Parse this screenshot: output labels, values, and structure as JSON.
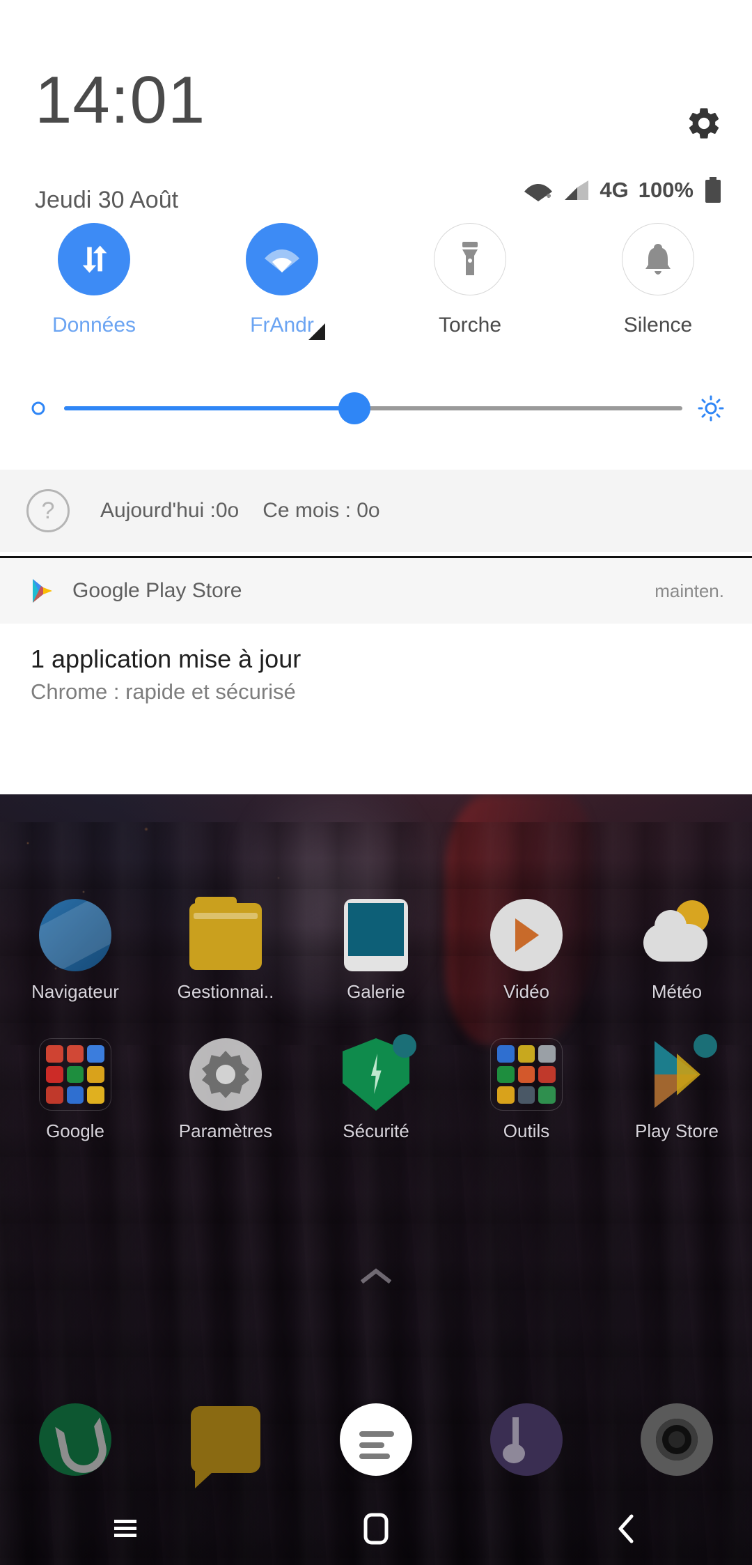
{
  "status_bar": {
    "clock": "14:01",
    "date": "Jeudi 30 Août",
    "network_type": "4G",
    "battery_percent": "100%",
    "icons": [
      "wifi-icon",
      "cellular-signal-icon",
      "battery-icon"
    ],
    "settings_icon": "gear-icon"
  },
  "quick_settings": {
    "tiles": [
      {
        "label": "Données",
        "icon": "data-sync-icon",
        "active": true
      },
      {
        "label": "FrAndr",
        "icon": "wifi-icon",
        "active": true,
        "expandable": true
      },
      {
        "label": "Torche",
        "icon": "flashlight-icon",
        "active": false
      },
      {
        "label": "Silence",
        "icon": "bell-icon",
        "active": false
      }
    ],
    "brightness": {
      "value_percent": 47,
      "low_icon": "brightness-low-icon",
      "high_icon": "brightness-high-icon"
    },
    "accent_color": "#3d8bf5",
    "inactive_color": "#8a8a8a"
  },
  "data_usage": {
    "help_icon": "question-mark-icon",
    "today_label": "Aujourd'hui :0o",
    "month_label": "Ce mois : 0o"
  },
  "notification": {
    "app_icon": "google-play-icon",
    "app_name": "Google Play Store",
    "time": "mainten.",
    "title": "1 application mise à jour",
    "subtitle": "Chrome : rapide et sécurisé"
  },
  "home_screen": {
    "rows": [
      [
        {
          "label": "Navigateur",
          "icon": "browser-icon"
        },
        {
          "label": "Gestionnai..",
          "icon": "file-manager-icon"
        },
        {
          "label": "Galerie",
          "icon": "gallery-icon"
        },
        {
          "label": "Vidéo",
          "icon": "video-player-icon"
        },
        {
          "label": "Météo",
          "icon": "weather-icon"
        }
      ],
      [
        {
          "label": "Google",
          "icon": "google-folder-icon"
        },
        {
          "label": "Paramètres",
          "icon": "settings-icon"
        },
        {
          "label": "Sécurité",
          "icon": "security-shield-icon",
          "badge": true
        },
        {
          "label": "Outils",
          "icon": "tools-folder-icon"
        },
        {
          "label": "Play Store",
          "icon": "play-store-icon",
          "badge": true
        }
      ]
    ],
    "drawer_hint_icon": "chevron-up-icon",
    "dock": [
      {
        "icon": "phone-icon"
      },
      {
        "icon": "messages-icon"
      },
      {
        "icon": "app-drawer-icon"
      },
      {
        "icon": "music-icon"
      },
      {
        "icon": "camera-icon"
      }
    ],
    "nav_bar": [
      {
        "icon": "recents-icon"
      },
      {
        "icon": "home-icon"
      },
      {
        "icon": "back-icon"
      }
    ]
  }
}
